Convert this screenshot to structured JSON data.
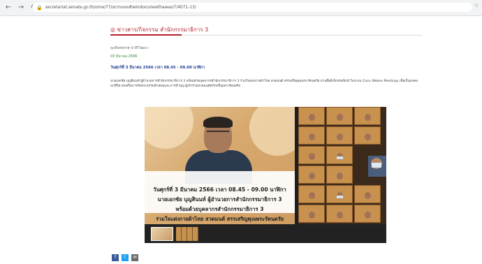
{
  "browser": {
    "back_icon": "←",
    "forward_icon": "→",
    "reload_icon": "C",
    "lock_icon": "🔒",
    "url": "secretariat.senate.go.th/ome/77/ocmvoodtwindon/viewthawas/7/4071-13/",
    "extension_icon": "☆"
  },
  "page": {
    "section_title": "◎ ข่าวสาร/กิจกรรม  สำนักกรรมาธิการ 3",
    "author": "ยุภดีสหสรรพ ปาลีวีวัฒนา",
    "date": "03 มีนาคม 2566",
    "headline": "วันศุกร์ที่ 3 มีนาคม 2566 เวลา 08.45 - 09.00 นาฬิกา",
    "body": "นายเอกชัย บุญสินนท์ ผู้อำนวยการสำนักกรรมาธิการ 3 พร้อมด้วยบุคลากรสำนักกรรมาธิการ 3 ร่วมใจแต่งกายผ้าไทย สวดมนต์ สรรเสริญคุณพระรัตนตรัย ผ่านสื่ออิเล็กทรอนิกส์ ในระบบ Cisco Webex Meetings เพื่อเป็นมงคลแก่ชีวิต ส่งเสริมการฟังพระธรรมคำสอนและการทำบุญ ผู้เข้าร่วมสวดมนต์สรรเสริญพระรัตนตรัย"
  },
  "gallery": {
    "caption_lines": [
      "วันศุกร์ที่ 3 มีนาคม 2566 เวลา 08.45 - 09.00 นาฬิกา",
      "นายเอกชัย บุญสินนท์ ผู้อำนวยการสำนักกรรมาธิการ 3",
      "พร้อมด้วยบุคลากรสำนักกรรมาธิการ 3",
      "ร่วมใจแต่งกายผ้าไทย สวดมนต์ สรรเสริญคุณพระรัตนตรัย"
    ]
  },
  "share": {
    "facebook_icon": "f",
    "twitter_icon": "t",
    "email_icon": "✉"
  }
}
